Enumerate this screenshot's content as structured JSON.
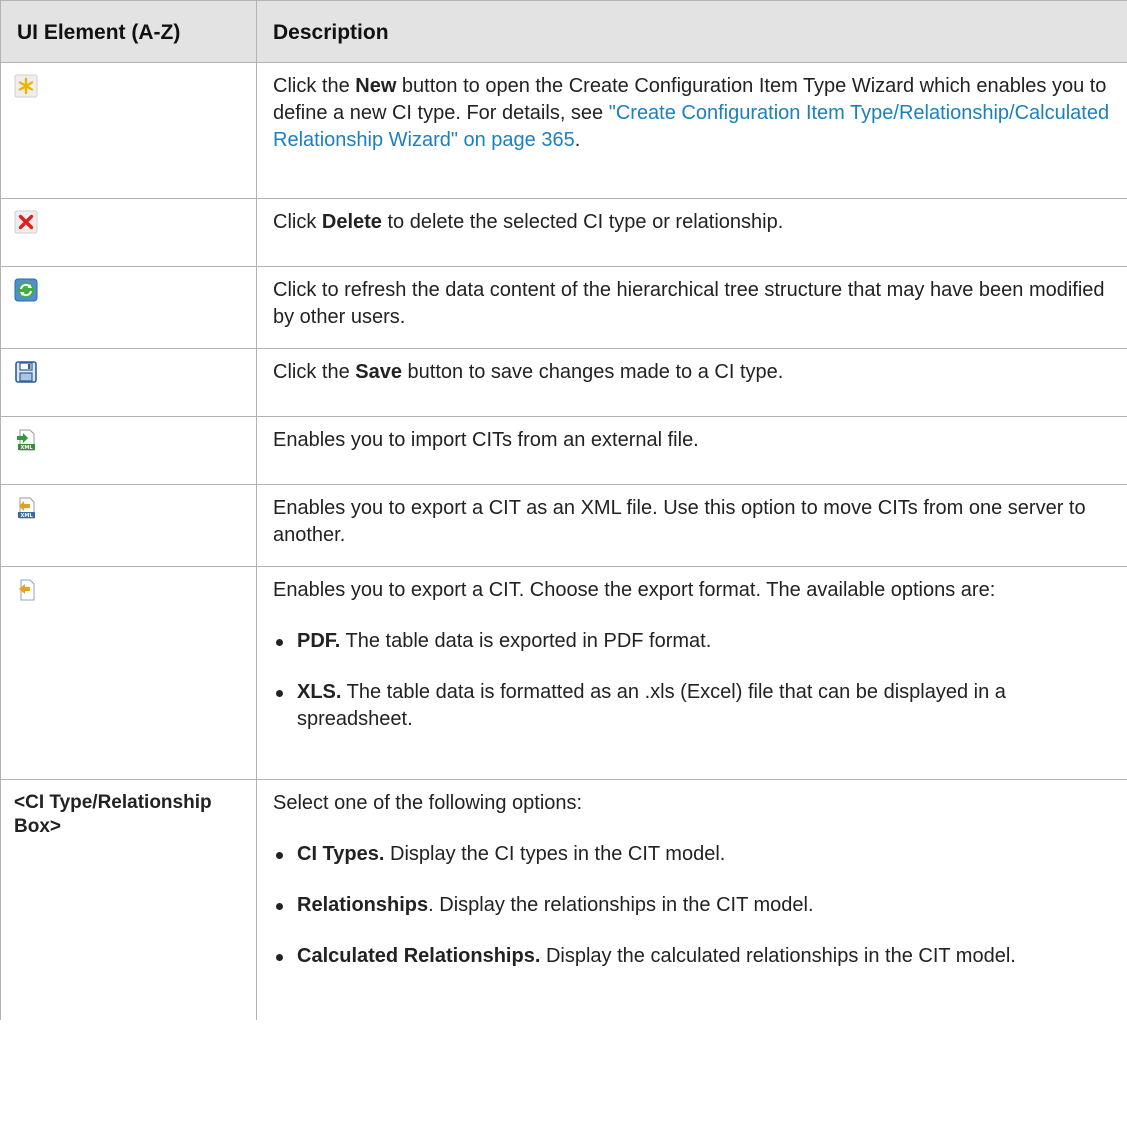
{
  "table": {
    "headers": {
      "element": "UI Element (A-Z)",
      "description": "Description"
    },
    "rows": {
      "new": {
        "icon": "new-asterisk-icon",
        "pre": "Click the ",
        "bold": "New",
        "post": " button to open the Create Configuration Item Type Wizard which enables you to define a new CI type. For details, see ",
        "link": "\"Create Configuration Item Type/Relationship/Calculated Relationship Wizard\" on page 365",
        "end": "."
      },
      "delete": {
        "icon": "delete-x-icon",
        "pre": "Click ",
        "bold": "Delete",
        "post": " to delete the selected CI type or relationship."
      },
      "refresh": {
        "icon": "refresh-icon",
        "text": "Click to refresh the data content of the hierarchical tree structure that may have been modified by other users."
      },
      "save": {
        "icon": "save-disk-icon",
        "pre": "Click the ",
        "bold": "Save",
        "post": " button to save changes made to a CI type."
      },
      "import": {
        "icon": "import-xml-icon",
        "text": "Enables you to import CITs from an external file."
      },
      "export_xml": {
        "icon": "export-xml-icon",
        "text": "Enables you to export a CIT as an XML file. Use this option to move CITs from one server to another."
      },
      "export": {
        "icon": "export-icon",
        "text": "Enables you to export a CIT. Choose the export format. The available options are:",
        "items": [
          {
            "bold": "PDF.",
            "text": " The table data is exported in PDF format."
          },
          {
            "bold": "XLS.",
            "text": " The table data is formatted as an .xls (Excel) file that can be displayed in a spreadsheet."
          }
        ]
      },
      "box": {
        "element": "<CI Type/Relationship Box>",
        "text": "Select one of the following options:",
        "items": [
          {
            "bold": "CI Types.",
            "text": " Display the CI types in the CIT model."
          },
          {
            "bold": "Relationships",
            "text": ". Display the relationships in the CIT model."
          },
          {
            "bold": "Calculated Relationships.",
            "text": " Display the calculated relationships in the CIT model."
          }
        ]
      }
    }
  }
}
